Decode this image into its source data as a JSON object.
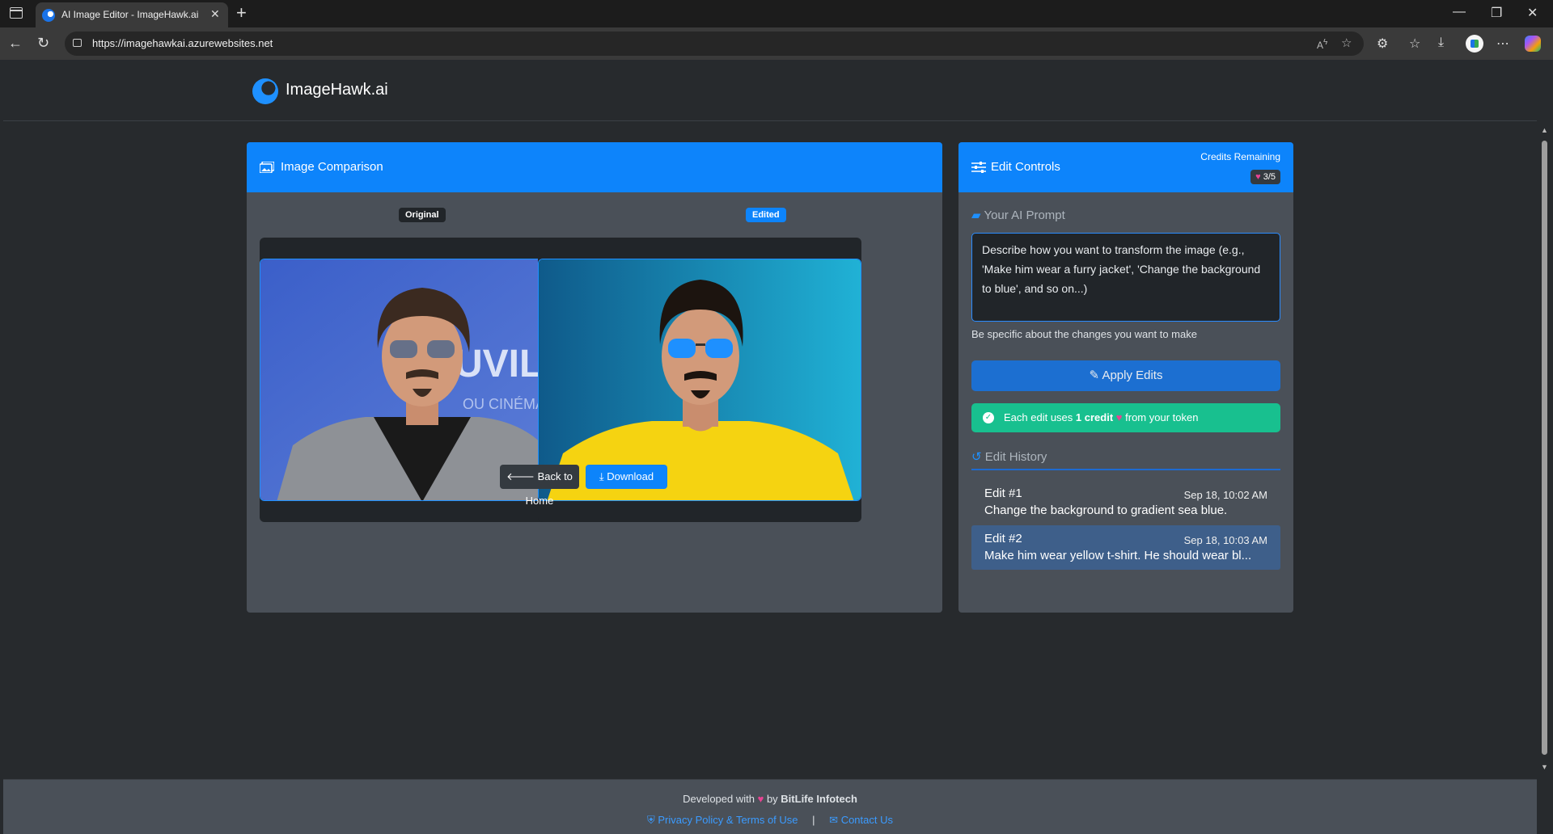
{
  "browser": {
    "tab_title": "AI Image Editor - ImageHawk.ai",
    "url": "https://imagehawkai.azurewebsites.net"
  },
  "site": {
    "brand": "ImageHawk.ai"
  },
  "comparison": {
    "title": "Image Comparison",
    "original_badge": "Original",
    "edited_badge": "Edited",
    "back_button": "Back to Home",
    "download_button": "Download"
  },
  "controls": {
    "title": "Edit Controls",
    "credits_label": "Credits Remaining",
    "credits_value": "3/5",
    "prompt_label": "Your AI Prompt",
    "prompt_placeholder": "Describe how you want to transform the image (e.g., 'Make him wear a furry jacket', 'Change the background to blue', and so on...)",
    "prompt_hint": "Be specific about the changes you want to make",
    "apply_button": "Apply Edits",
    "info_prefix": "Each edit uses",
    "info_credit": "1 credit",
    "info_suffix": "from your token",
    "history_title": "Edit History",
    "history": [
      {
        "title": "Edit #1",
        "date": "Sep 18, 10:02 AM",
        "text": "Change the background to gradient sea blue."
      },
      {
        "title": "Edit #2",
        "date": "Sep 18, 10:03 AM",
        "text": "Make him wear yellow t-shirt. He should wear bl..."
      }
    ]
  },
  "footer": {
    "developed_with": "Developed with",
    "by": "by",
    "company": "BitLife Infotech",
    "privacy": "Privacy Policy & Terms of Use",
    "separator": "|",
    "contact": "Contact Us"
  },
  "colors": {
    "primary": "#0d84fb",
    "success": "#18c08f",
    "card": "#4a5058",
    "background": "#272a2d"
  }
}
